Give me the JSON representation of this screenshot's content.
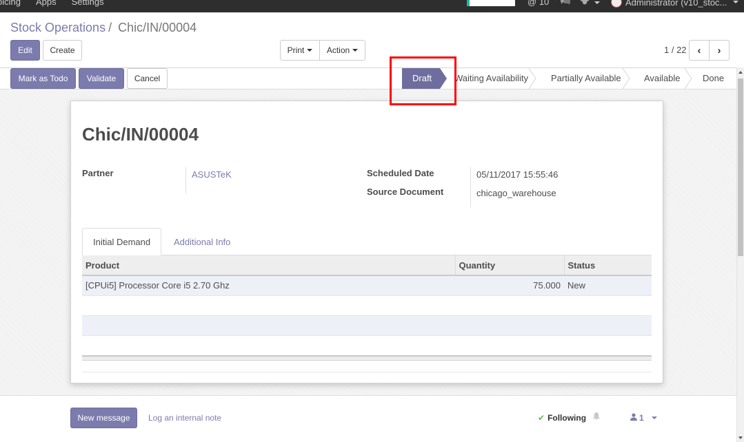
{
  "navbar": {
    "menu": [
      "oicing",
      "Apps",
      "Settings"
    ],
    "activity_count": "10",
    "user": "Administrator (v10_stoc..."
  },
  "breadcrumb": {
    "parent": "Stock Operations",
    "separator": "/",
    "current": "Chic/IN/00004"
  },
  "toolbar": {
    "edit": "Edit",
    "create": "Create",
    "print": "Print",
    "action": "Action",
    "pager": "1 / 22"
  },
  "statusbar": {
    "buttons": [
      "Mark as Todo",
      "Validate",
      "Cancel"
    ],
    "stages": [
      "Draft",
      "Waiting Availability",
      "Partially Available",
      "Available",
      "Done"
    ],
    "active_stage": "Draft"
  },
  "form": {
    "title": "Chic/IN/00004",
    "partner_label": "Partner",
    "partner_value": "ASUSTeK",
    "scheduled_date_label": "Scheduled Date",
    "scheduled_date_value": "05/11/2017 15:55:46",
    "source_document_label": "Source Document",
    "source_document_value": "chicago_warehouse"
  },
  "tabs": [
    "Initial Demand",
    "Additional Info"
  ],
  "table": {
    "columns": [
      "Product",
      "Quantity",
      "Status"
    ],
    "rows": [
      {
        "product": "[CPUi5] Processor Core i5 2.70 Ghz",
        "quantity": "75.000",
        "status": "New"
      }
    ]
  },
  "chatter": {
    "new_message": "New message",
    "log_note": "Log an internal note",
    "following": "Following",
    "followers_count": "1"
  },
  "colors": {
    "primary": "#7c7bad",
    "active_stage": "#6e6d9e",
    "navbar": "#2e2e2e"
  }
}
